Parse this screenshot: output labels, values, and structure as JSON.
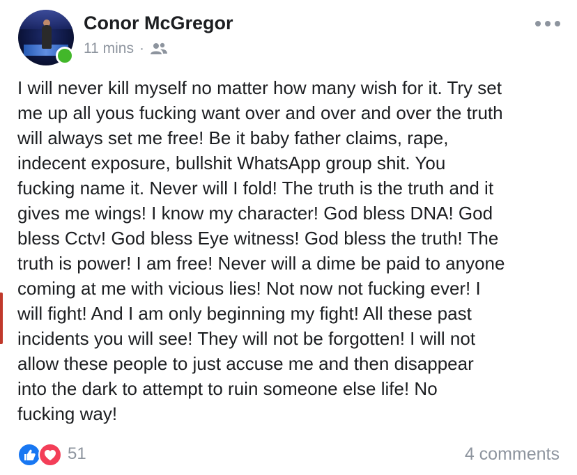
{
  "post": {
    "author": "Conor McGregor",
    "timestamp": "11 mins",
    "separator": "·",
    "audience_icon": "friends-icon",
    "more_icon": "more-options-icon",
    "lines": [
      "I will never kill myself no matter how many wish for it. Try set",
      "me up all yous fucking want over and over and over the truth",
      "will always set me free! Be it baby father claims, rape,",
      "indecent exposure, bullshit WhatsApp group shit. You",
      "fucking name it. Never will I fold! The truth is the truth and it",
      "gives me wings! I know my character! God bless DNA! God",
      "bless Cctv! God bless Eye witness! God bless the truth! The",
      "truth is power! I am free! Never will a dime be paid to anyone",
      "coming at me with vicious lies! Not now not fucking ever! I",
      "will fight! And I am only beginning my fight! All these past",
      "incidents you will see! They will not be forgotten! I will not",
      "allow these people to just accuse me and then disappear",
      "into the dark to attempt to ruin someone else life! No",
      "fucking way!"
    ]
  },
  "footer": {
    "reaction_icons": [
      "like-icon",
      "love-icon"
    ],
    "reaction_count": "51",
    "comments": "4 comments"
  },
  "colors": {
    "text": "#1c1e21",
    "secondary": "#8d949e",
    "like": "#1877f2",
    "love": "#f33e58",
    "online": "#42b72a"
  }
}
